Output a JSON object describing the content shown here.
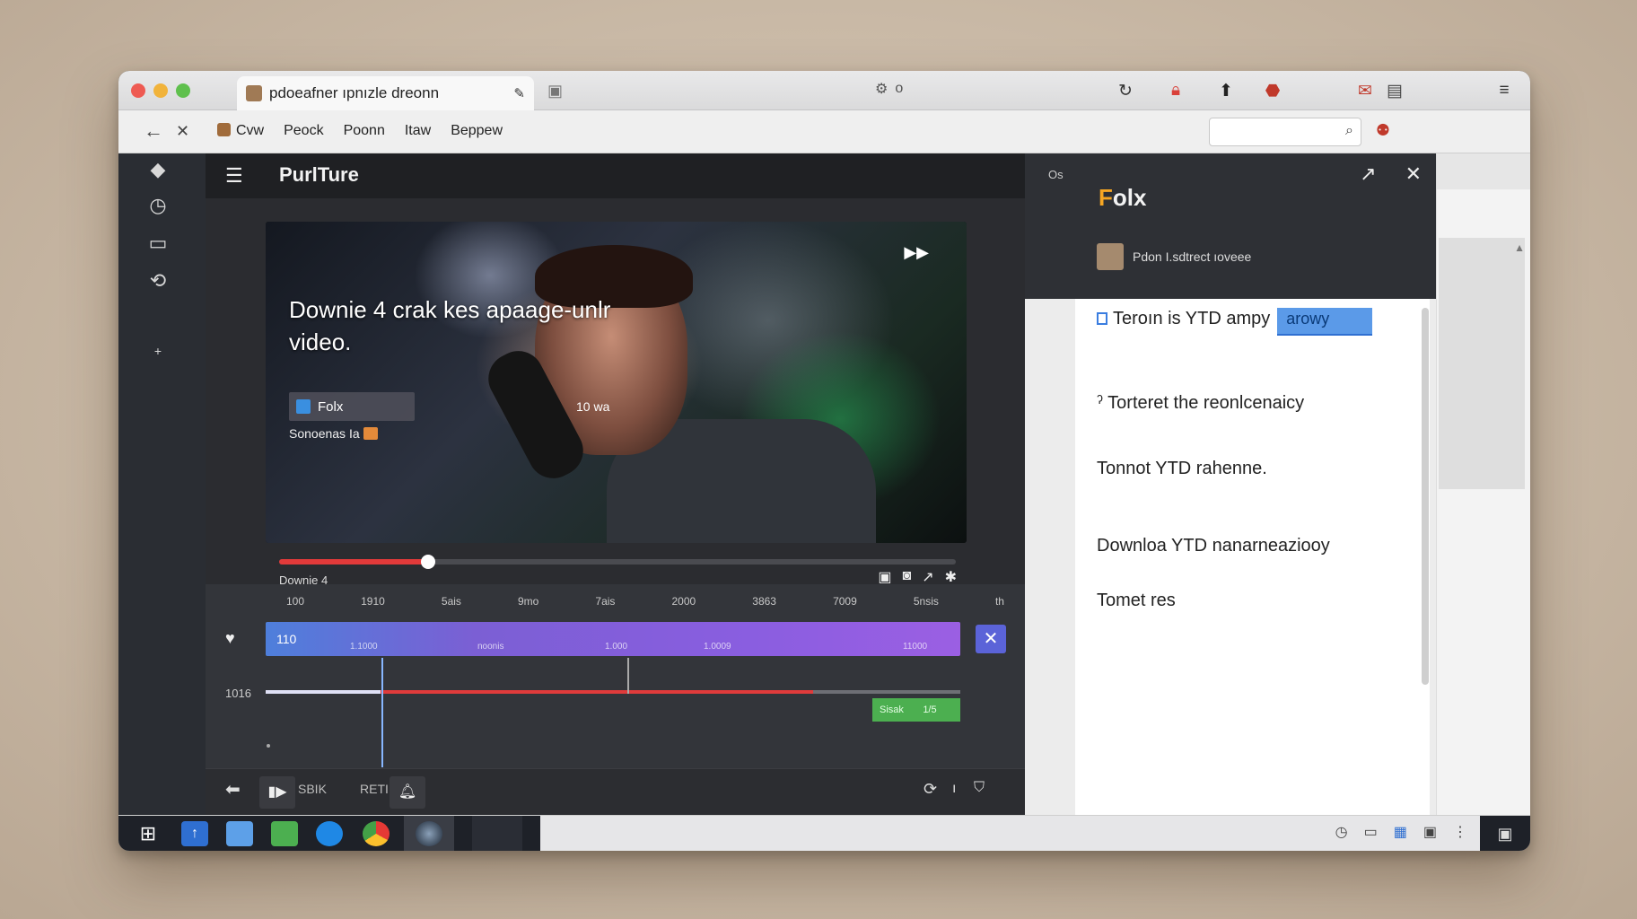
{
  "browser": {
    "tab_title": "pdoeafner ıpnızle dreonn",
    "center_indicator": "o",
    "bookmarks": [
      "Cvw",
      "Peock",
      "Poonn",
      "Itaw",
      "Beppew"
    ],
    "search_placeholder": ""
  },
  "app": {
    "title": "PurlTure",
    "video": {
      "caption": "Downie 4 crak kes apaage-unlr video.",
      "chip_label": "Folx",
      "sub_label": "Sonoenas Ia",
      "time_text": "10 wa",
      "label_below": "Downie 4",
      "progress_fraction": 0.22
    },
    "timeline": {
      "ruler": [
        "100",
        "1910",
        "5ais",
        "9mo",
        "7ais",
        "2000",
        "3863",
        "7009",
        "5nsis",
        "th"
      ],
      "track1_label": "110",
      "track1_segments": [
        "1.1000",
        "noonis",
        "1.000",
        "1.0009",
        "11000"
      ],
      "row2_label": "1016",
      "clip_label": "Sisak",
      "clip_label2": "1/5"
    },
    "bottom_bar": {
      "label1": "SBIK",
      "label2": "RETI"
    }
  },
  "panel": {
    "small_label": "Os",
    "title_first": "F",
    "title_rest": "olx",
    "account_text": "Pdon I.sdtrect ıoveee",
    "items": [
      {
        "text": "Teroın is YTD ampy",
        "tag": "arowy"
      },
      {
        "text": "Torteret the reonlcenaicy"
      },
      {
        "text": "Tonnot YTD rahenne."
      },
      {
        "text": "Downloa YTD nanarneaziooy"
      },
      {
        "text": "Tomet res"
      }
    ]
  },
  "colors": {
    "accent_red": "#e23a3a",
    "track_purple": "#8a5ee0",
    "track_blue": "#4e7fdb",
    "clip_green": "#4caf50",
    "tag_blue": "#5b9ae8"
  }
}
